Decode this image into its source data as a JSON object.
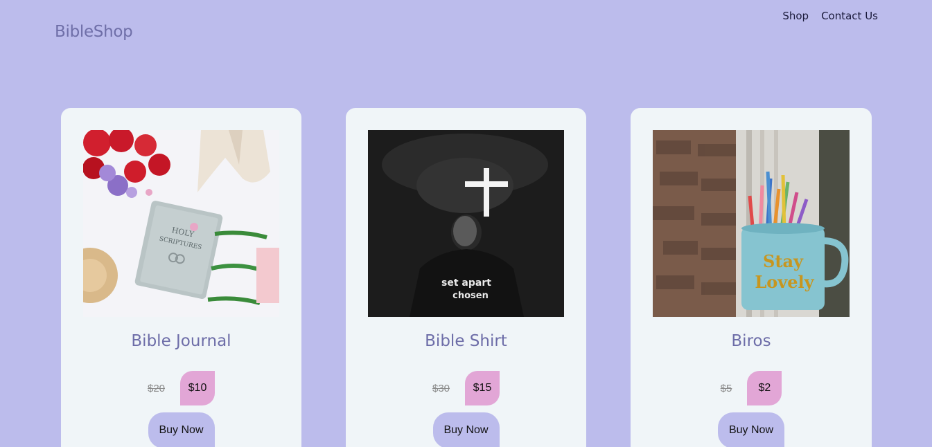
{
  "header": {
    "brand": "BibleShop",
    "nav": [
      {
        "label": "Shop"
      },
      {
        "label": "Contact Us"
      }
    ]
  },
  "products": [
    {
      "title": "Bible Journal",
      "old_price": "$20",
      "new_price": "$10",
      "buy_label": "Buy Now",
      "image_alt": "Holy Scriptures bible with roses and heels"
    },
    {
      "title": "Bible Shirt",
      "old_price": "$30",
      "new_price": "$15",
      "buy_label": "Buy Now",
      "image_alt": "Man in set apart chosen t-shirt under lit cross"
    },
    {
      "title": "Biros",
      "old_price": "$5",
      "new_price": "$2",
      "buy_label": "Buy Now",
      "image_alt": "Stay Lovely mug full of pens"
    }
  ],
  "image_text": {
    "bible_cover": [
      "HOLY",
      "SCRIPTURES"
    ],
    "shirt_lines": [
      "set apart",
      "chosen"
    ],
    "mug_lines": [
      "Stay",
      "Lovely"
    ]
  },
  "colors": {
    "background": "#bcbcec",
    "card": "#f0f5f8",
    "price_badge": "#e2a6d6",
    "buy_button": "#bcbcec",
    "brand_text": "#6f6fa8"
  }
}
